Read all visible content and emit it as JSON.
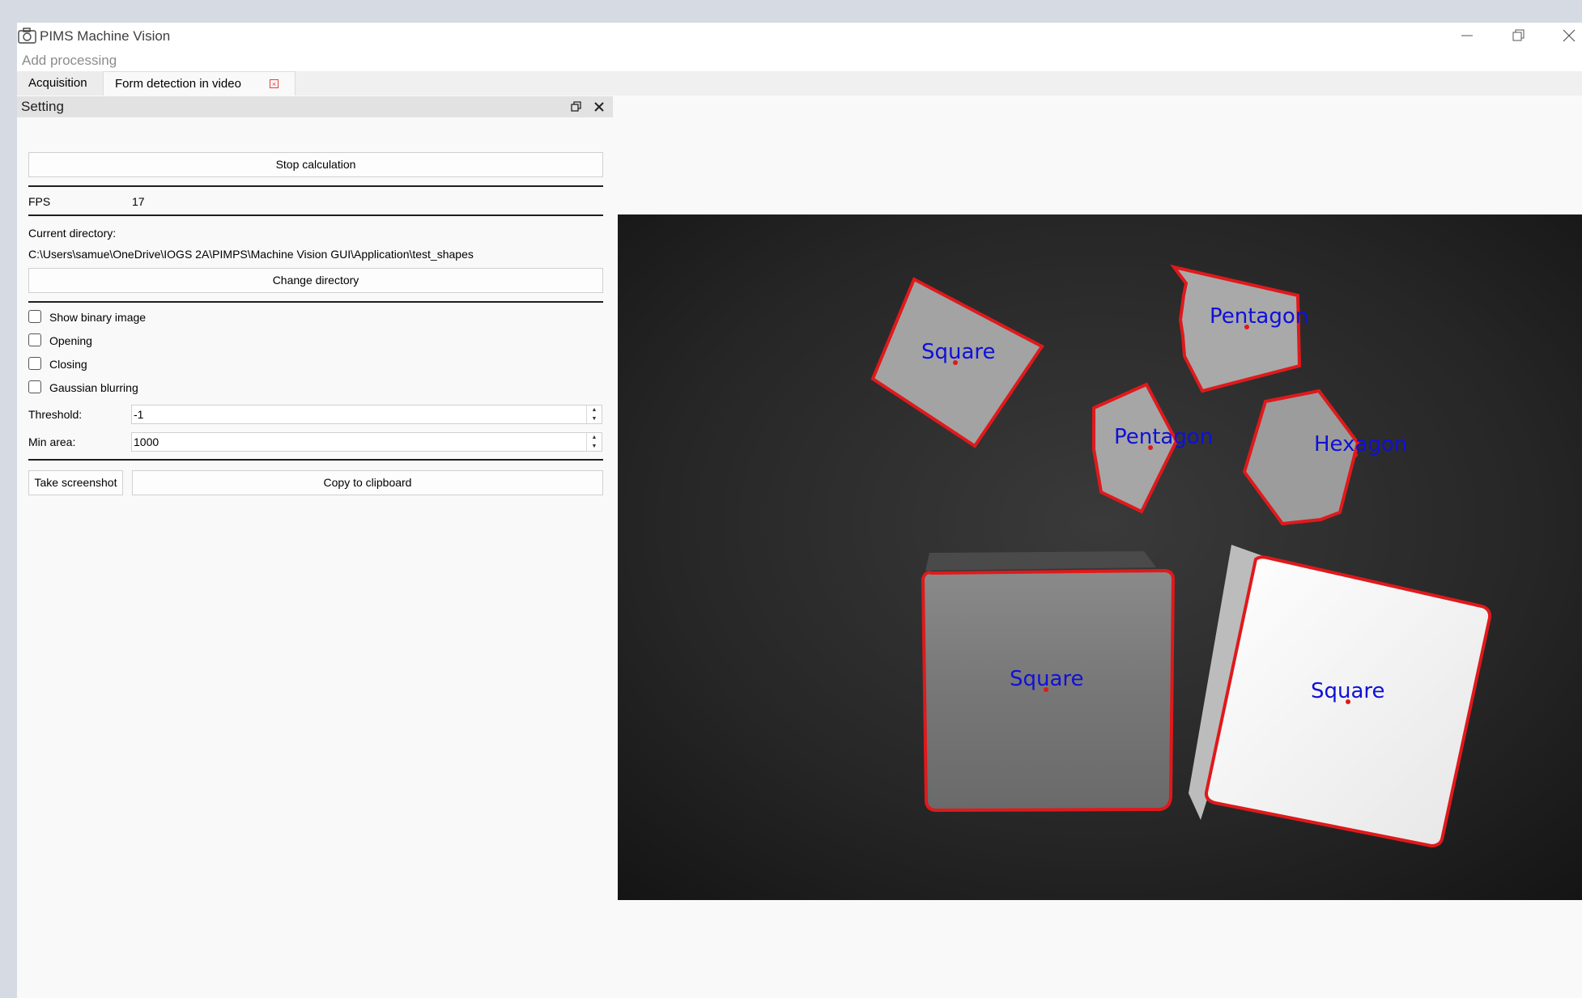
{
  "window": {
    "title": "PIMS Machine Vision",
    "menu": [
      "Add processing"
    ],
    "tabs": [
      {
        "label": "Acquisition",
        "active": false
      },
      {
        "label": "Form detection in video",
        "active": true,
        "closable": true
      }
    ]
  },
  "panel": {
    "title": "Setting",
    "stop_button": "Stop calculation",
    "fps_label": "FPS",
    "fps_value": "17",
    "directory_label": "Current directory:",
    "directory_path": "C:\\Users\\samue\\OneDrive\\IOGS 2A\\PIMPS\\Machine Vision GUI\\Application\\test_shapes",
    "change_directory_button": "Change directory",
    "checkboxes": [
      {
        "label": "Show binary image",
        "checked": false
      },
      {
        "label": "Opening",
        "checked": false
      },
      {
        "label": "Closing",
        "checked": false
      },
      {
        "label": "Gaussian blurring",
        "checked": false
      }
    ],
    "threshold_label": "Threshold:",
    "threshold_value": "-1",
    "min_area_label": "Min area:",
    "min_area_value": "1000",
    "screenshot_button": "Take screenshot",
    "clipboard_button": "Copy to clipboard"
  },
  "detections": [
    {
      "label": "Square"
    },
    {
      "label": "Pentagon"
    },
    {
      "label": "Pentagon"
    },
    {
      "label": "Hexagon"
    },
    {
      "label": "Square"
    },
    {
      "label": "Square"
    }
  ],
  "colors": {
    "contour": "#e0191b",
    "label": "#1010d8",
    "centroid": "#e0191b"
  }
}
